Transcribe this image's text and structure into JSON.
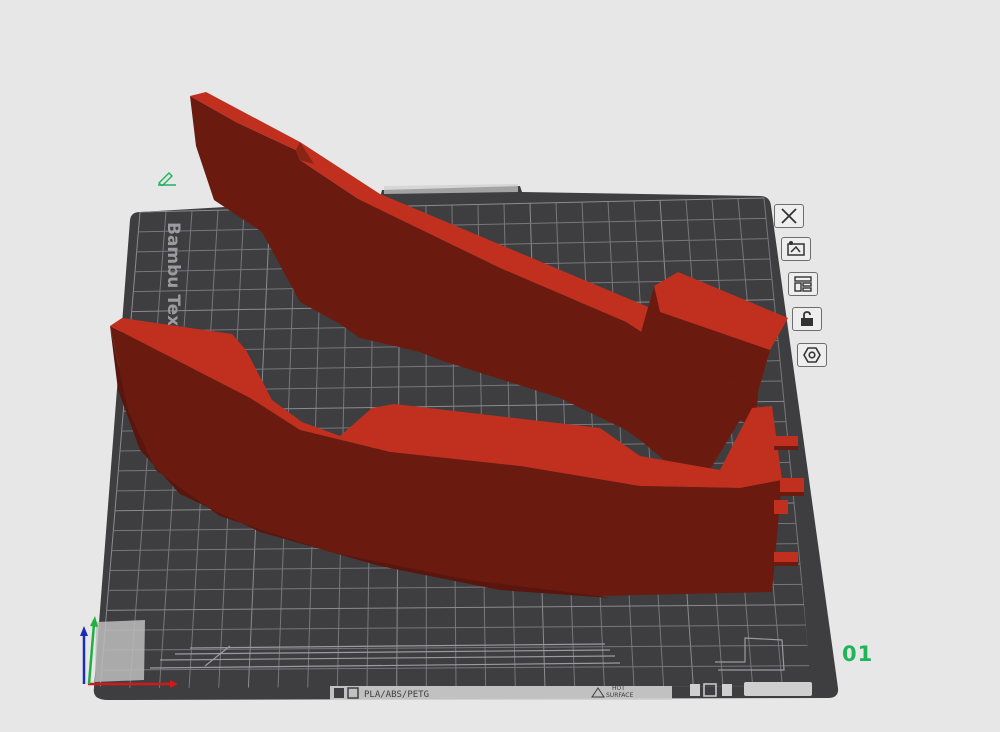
{
  "plate": {
    "number": "01",
    "brand_text": "Bambu Textu",
    "bottom_label": "PLA/ABS/PETG",
    "hot_label_1": "HOT",
    "hot_label_2": "SURFACE"
  },
  "plate_tools": [
    {
      "name": "close-plate-button",
      "icon": "close-icon"
    },
    {
      "name": "pick-plate-button",
      "icon": "pick-icon"
    },
    {
      "name": "arrange-plate-button",
      "icon": "arrange-icon"
    },
    {
      "name": "lock-plate-button",
      "icon": "lock-icon"
    },
    {
      "name": "plate-settings-button",
      "icon": "settings-hex-icon"
    }
  ],
  "colors": {
    "background": "#e7e7e8",
    "plate": "#3f3f42",
    "grid": "#74747a",
    "model_light": "#c0301f",
    "model_dark": "#6a1910",
    "plate_number": "#1fb35a"
  }
}
